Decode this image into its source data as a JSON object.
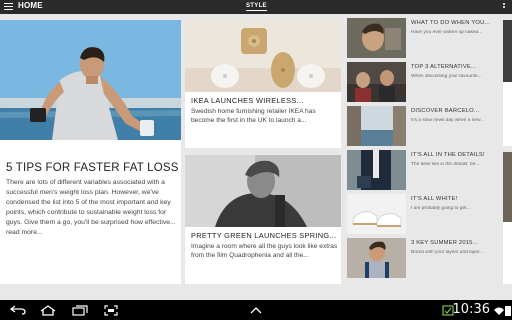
{
  "app": {
    "nav_label": "HOME",
    "brand": "STYLE"
  },
  "featured": {
    "title": "5 TIPS FOR FASTER FAT LOSS",
    "excerpt": "There are lots of different variables associated with a successful men's weight loss plan. However, we've condensed the list into 5 of the most important and key points, which contribute to sustainable weight loss for guys. Give them a go, you'll be surprised how effective... read more..."
  },
  "mid_articles": [
    {
      "title": "IKEA LAUNCHES WIRELESS...",
      "excerpt": "Swedish home furnishing retailer IKEA has become the first in the UK to launch a..."
    },
    {
      "title": "PRETTY GREEN LAUNCHES SPRING...",
      "excerpt": "Imagine a room where all the guys look like extras from the film Quadrophenia and all the..."
    }
  ],
  "side_articles": [
    {
      "title": "WHAT TO DO WHEN YOU...",
      "subtitle": "Have you ever woken up naked..."
    },
    {
      "title": "TOP 3 ALTERNATIVE...",
      "subtitle": "When discussing your favourite..."
    },
    {
      "title": "DISCOVER BARCELO...",
      "subtitle": "It's a slow news day when a new..."
    },
    {
      "title": "IT'S ALL IN THE DETAILS!",
      "subtitle": "The devil lies in the details: be..."
    },
    {
      "title": "IT'S ALL WHITE!",
      "subtitle": "I am probably going to get..."
    },
    {
      "title": "3 KEY SUMMER 2015...",
      "subtitle": "Bored with your layers and layer..."
    }
  ],
  "pager": {
    "pages": 2,
    "current": 1
  },
  "status_bar": {
    "time": "10:36",
    "icons": [
      "back-icon",
      "home-icon",
      "recent-apps-icon",
      "screenshot-icon",
      "chevron-up-icon",
      "notification-icon",
      "wifi-icon",
      "battery-icon"
    ]
  },
  "colors": {
    "action_bar": "#2a2a2a",
    "background": "#e8e8e8",
    "card": "#ffffff",
    "system_bar": "#000000"
  }
}
